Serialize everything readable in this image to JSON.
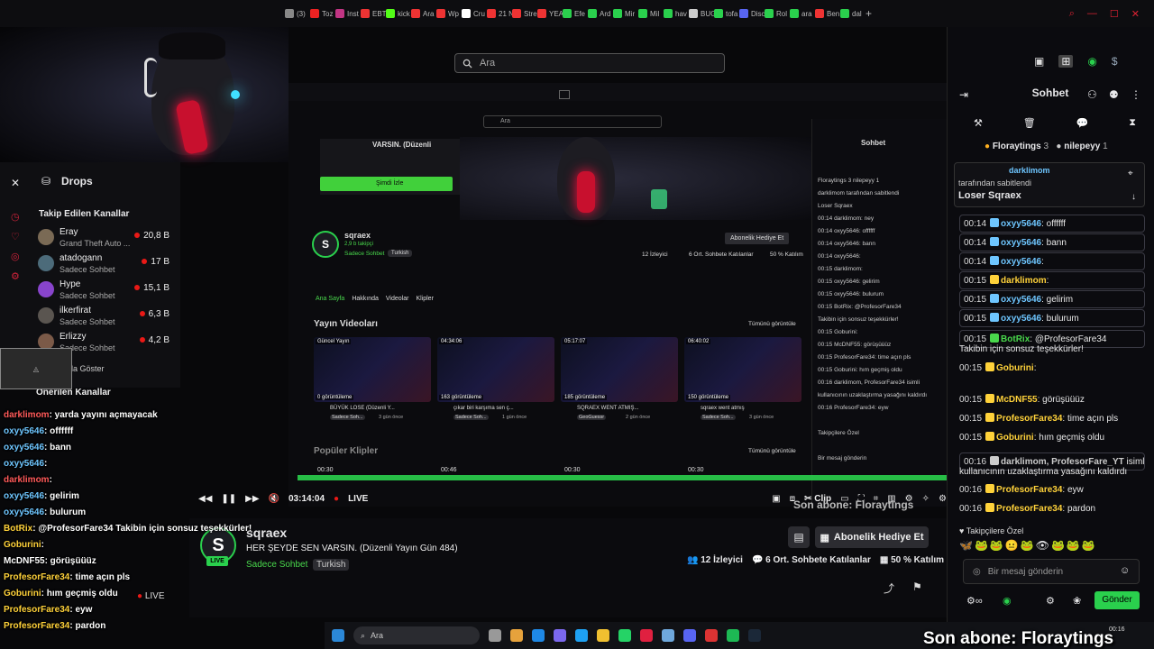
{
  "browser": {
    "tabs": [
      {
        "label": "(3)",
        "color": "#888"
      },
      {
        "label": "Toz",
        "color": "#e22"
      },
      {
        "label": "Inst",
        "color": "#c13584"
      },
      {
        "label": "EBT",
        "color": "#e33"
      },
      {
        "label": "kick",
        "color": "#53fc18"
      },
      {
        "label": "Ara",
        "color": "#e33"
      },
      {
        "label": "Wp",
        "color": "#e33"
      },
      {
        "label": "Cru",
        "color": "#fff"
      },
      {
        "label": "21 N",
        "color": "#e33"
      },
      {
        "label": "Stre",
        "color": "#e33"
      },
      {
        "label": "YEA",
        "color": "#e33"
      },
      {
        "label": "Efe",
        "color": "#2ad04d"
      },
      {
        "label": "Ard",
        "color": "#2ad04d"
      },
      {
        "label": "Mir",
        "color": "#2ad04d"
      },
      {
        "label": "Mil",
        "color": "#2ad04d"
      },
      {
        "label": "hav",
        "color": "#2ad04d"
      },
      {
        "label": "BUG",
        "color": "#ccc"
      },
      {
        "label": "tofa",
        "color": "#2ad04d"
      },
      {
        "label": "Disc",
        "color": "#5865f2"
      },
      {
        "label": "Rol",
        "color": "#2ad04d"
      },
      {
        "label": "ara",
        "color": "#2ad04d"
      },
      {
        "label": "Ben",
        "color": "#e33"
      },
      {
        "label": "dal",
        "color": "#2ad04d"
      }
    ],
    "new_tab": "+"
  },
  "search": {
    "placeholder": "Ara"
  },
  "drops": {
    "title": "Drops",
    "followed_title": "Takip Edilen Kanallar",
    "channels": [
      {
        "name": "Eray",
        "sub": "Grand Theft Auto ...",
        "count": "20,8 B",
        "color": "#7a6a55"
      },
      {
        "name": "atadogann",
        "sub": "Sadece Sohbet",
        "count": "17 B",
        "color": "#4c6b7a"
      },
      {
        "name": "Hype",
        "sub": "Sadece Sohbet",
        "count": "15,1 B",
        "color": "#8844cc"
      },
      {
        "name": "ilkerfirat",
        "sub": "Sadece Sohbet",
        "count": "6,3 B",
        "color": "#5a5550"
      },
      {
        "name": "Erlizzy",
        "sub": "Sadece Sohbet",
        "count": "4,2 B",
        "color": "#7b5a48"
      }
    ],
    "show_more": "Daha Fazla Göster",
    "recommended": "Önerilen Kanallar"
  },
  "left_chat": [
    {
      "user": "darklimom",
      "text": ": yarda yayını açmayacak",
      "color": "#ff5a5a"
    },
    {
      "user": "oxyy5646",
      "text": ": offffff",
      "color": "#6ec6ff"
    },
    {
      "user": "oxyy5646",
      "text": ": bann",
      "color": "#6ec6ff"
    },
    {
      "user": "oxyy5646",
      "text": ":",
      "color": "#6ec6ff"
    },
    {
      "user": "darklimom",
      "text": ":",
      "color": "#ff5a5a"
    },
    {
      "user": "oxyy5646",
      "text": ": gelirim",
      "color": "#6ec6ff"
    },
    {
      "user": "oxyy5646",
      "text": ": bulurum",
      "color": "#6ec6ff"
    },
    {
      "user": "BotRix",
      "text": ": @ProfesorFare34 Takibin için sonsuz teşekkürler!",
      "color": "#ffd23a"
    },
    {
      "user": "Goburini",
      "text": ":",
      "color": "#ffd23a"
    },
    {
      "user": "McDNF55",
      "text": ": görüşüüüz",
      "color": "#ffffff"
    },
    {
      "user": "ProfesorFare34",
      "text": ": time açın pls",
      "color": "#ffd23a"
    },
    {
      "user": "Goburini",
      "text": ": hım geçmiş oldu",
      "color": "#ffd23a"
    },
    {
      "user": "ProfesorFare34",
      "text": ": eyw",
      "color": "#ffd23a"
    },
    {
      "user": "ProfesorFare34",
      "text": ": pardon",
      "color": "#ffd23a"
    }
  ],
  "nested": {
    "promo_title": "VARSIN. (Düzenli",
    "watch_now": "Şimdi İzle",
    "channel": "sqraex",
    "followers": "2,9 b takipçi",
    "category": "Sadece Sohbet",
    "language": "Turkish",
    "subscribe": "Abonelik Hediye Et",
    "viewers": "12 İzleyici",
    "chatters": "6 Ort. Sohbete Katılanlar",
    "rate": "50 % Katılım",
    "tabs": [
      "Ana Sayfa",
      "Hakkında",
      "Videolar",
      "Klipler"
    ],
    "videos_title": "Yayın Videoları",
    "see_all": "Tümünü görüntüle",
    "clips_title": "Popüler Klipler",
    "videos": [
      {
        "badge": "Güncel Yayın",
        "views": "0 görüntüleme",
        "title": "BÜYÜK LOSE (Düzenli Y...",
        "cat": "Sadece Soh...",
        "ago": "3 gün önce"
      },
      {
        "badge": "04:34:06",
        "views": "163 görüntüleme",
        "title": "çıkar biri karşıma sen ç...",
        "cat": "Sadece Soh...",
        "ago": "1 gün önce"
      },
      {
        "badge": "05:17:07",
        "views": "185 görüntüleme",
        "title": "SQRAEX WENT ATMIŞ...",
        "cat": "GeoGuessr",
        "ago": "2 gün önce"
      },
      {
        "badge": "06:40:02",
        "views": "150 görüntüleme",
        "title": "sqraex went atmış",
        "cat": "Sadece Soh...",
        "ago": "3 gün önce"
      }
    ],
    "clip_times": [
      "00:30",
      "00:46",
      "00:30",
      "00:30"
    ],
    "chat_title": "Sohbet",
    "chat_lines": [
      "Floraytings 3    nilepeyy 1",
      "darklimom tarafından sabitlendi",
      "Loser Sqraex",
      "00:14 darklimom: ney",
      "00:14 oxyy5646: offffff",
      "00:14 oxyy5646: bann",
      "00:14 oxyy5646:",
      "00:15 darklimom:",
      "00:15 oxyy5646: gelirim",
      "00:15 oxyy5646: bulurum",
      "00:15 BotRix: @ProfesorFare34",
      "Takibin için sonsuz teşekkürler!",
      "00:15 Goburini:",
      "00:15 McDNF55: görüşüüüz",
      "00:15 ProfesorFare34: time açın pls",
      "00:15 Goburini: hım geçmiş oldu",
      "00:16 darklimom, ProfesorFare34 isimli",
      "kullanıcının uzaklaştırma yasağını kaldırdı",
      "00:16 ProfesorFare34: eyw",
      "",
      "Takipçilere Özel",
      "",
      "Bir mesaj gönderin"
    ]
  },
  "player": {
    "time": "03:14:04",
    "live": "LIVE",
    "clip": "Clip"
  },
  "stream_info": {
    "avatar_letter": "S",
    "live": "LIVE",
    "channel": "sqraex",
    "title": "HER ŞEYDE SEN VARSIN. (Düzenli Yayın Gün 484)",
    "category": "Sadece Sohbet",
    "language": "Turkish",
    "viewers": "12 İzleyici",
    "chatters": "6 Ort. Sohbete Katılanlar",
    "rate": "50 % Katılım",
    "subscribe": "Abonelik Hediye Et",
    "sidebar_live": "LIVE"
  },
  "chat": {
    "title": "Sohbet",
    "gifters": [
      {
        "name": "Floraytings",
        "count": "3"
      },
      {
        "name": "nilepeyy",
        "count": "1"
      }
    ],
    "pinned_by": "darklimom",
    "pinned_note": "tarafından sabitlendi",
    "pinned_text": "Loser Sqraex",
    "messages": [
      {
        "time": "00:14",
        "user": "oxyy5646",
        "text": ": offffff",
        "color": "#6ec6ff",
        "boxed": true
      },
      {
        "time": "00:14",
        "user": "oxyy5646",
        "text": ": bann",
        "color": "#6ec6ff",
        "boxed": true
      },
      {
        "time": "00:14",
        "user": "oxyy5646",
        "text": ":",
        "color": "#6ec6ff",
        "boxed": true
      },
      {
        "time": "00:15",
        "user": "darklimom",
        "text": ":",
        "color": "#ffd23a",
        "boxed": true
      },
      {
        "time": "00:15",
        "user": "oxyy5646",
        "text": ": gelirim",
        "color": "#6ec6ff",
        "boxed": true
      },
      {
        "time": "00:15",
        "user": "oxyy5646",
        "text": ": bulurum",
        "color": "#6ec6ff",
        "boxed": true
      },
      {
        "time": "00:15",
        "user": "BotRix",
        "text": ": @ProfesorFare34",
        "color": "#49d84c",
        "boxed": true
      },
      {
        "time": "",
        "user": "",
        "text": "Takibin için sonsuz teşekkürler!",
        "color": "#e8e8e8",
        "boxed": false
      },
      {
        "time": "00:15",
        "user": "Goburini",
        "text": ":",
        "color": "#ffd23a",
        "boxed": false
      },
      {
        "time": "00:15",
        "user": "McDNF55",
        "text": ": görüşüüüz",
        "color": "#ffd23a",
        "boxed": false
      },
      {
        "time": "00:15",
        "user": "ProfesorFare34",
        "text": ": time açın pls",
        "color": "#ffd23a",
        "boxed": false
      },
      {
        "time": "00:15",
        "user": "Goburini",
        "text": ": hım geçmiş oldu",
        "color": "#ffd23a",
        "boxed": false
      },
      {
        "time": "00:16",
        "user": "darklimom, ProfesorFare_YT",
        "text": " isimli",
        "color": "#cccccc",
        "boxed": true
      },
      {
        "time": "",
        "user": "",
        "text": "kullanıcının uzaklaştırma yasağını kaldırdı",
        "color": "#cccccc",
        "boxed": false
      },
      {
        "time": "00:16",
        "user": "ProfesorFare34",
        "text": ": eyw",
        "color": "#ffd23a",
        "boxed": false
      },
      {
        "time": "00:16",
        "user": "ProfesorFare34",
        "text": ": pardon",
        "color": "#ffd23a",
        "boxed": false
      }
    ],
    "followers_only": "Takipçilere Özel",
    "input_placeholder": "Bir mesaj gönderin",
    "send": "Gönder"
  },
  "taskbar": {
    "search": "Ara",
    "time": "00:16"
  },
  "overlay": {
    "last_sub": "Son abone: Floraytings",
    "last_sub_nested": "Son abone: Floraytings"
  },
  "colors": {
    "accent": "#2ad04d",
    "bg": "#08080a",
    "live": "#e91916"
  }
}
